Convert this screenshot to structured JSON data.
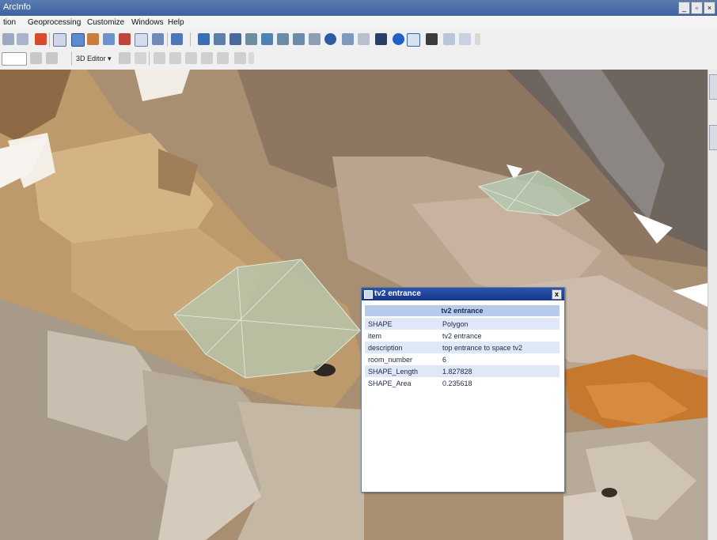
{
  "window": {
    "title": "ArcInfo"
  },
  "menu": [
    "tion",
    "Geoprocessing",
    "Customize",
    "Windows",
    "Help"
  ],
  "toolbar": {
    "editor_label": "3D Editor ▾"
  },
  "identify": {
    "title": "tv2 entrance",
    "header": "tv2 entrance",
    "close": "x",
    "rows": [
      {
        "key": "SHAPE",
        "value": "Polygon"
      },
      {
        "key": "item",
        "value": "tv2 entrance"
      },
      {
        "key": "description",
        "value": "top entrance to space tv2"
      },
      {
        "key": "room_number",
        "value": "6"
      },
      {
        "key": "SHAPE_Length",
        "value": "1.827828"
      },
      {
        "key": "SHAPE_Area",
        "value": "0.235618"
      }
    ]
  },
  "colors": {
    "accent": "#2a55a8",
    "header_fill": "#b6cbe9",
    "rock_tan": "#c9aa80",
    "highlight_polygon": "#b5c8b0"
  }
}
